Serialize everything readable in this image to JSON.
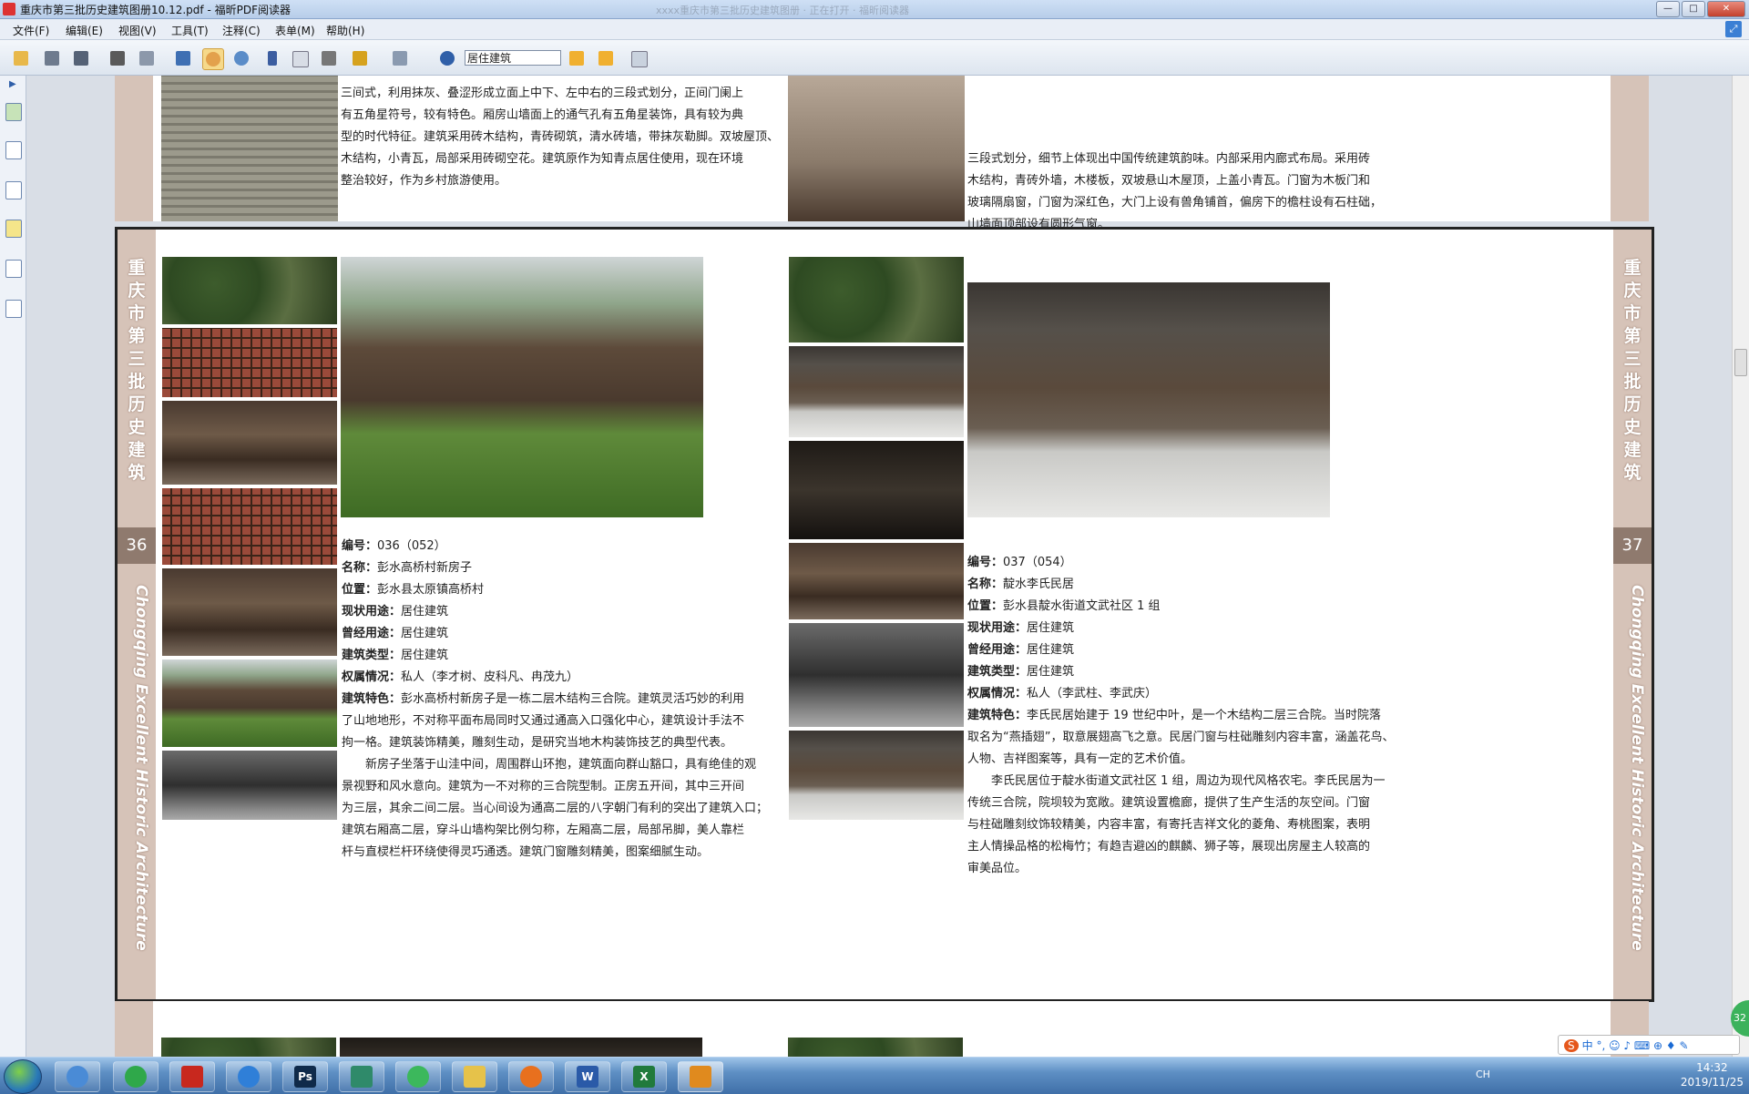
{
  "window": {
    "title": "重庆市第三批历史建筑图册10.12.pdf - 福昕PDF阅读器",
    "ghost_title": "xxxx重庆市第三批历史建筑图册 · 正在打开 · 福昕阅读器",
    "min": "—",
    "max": "□",
    "close": "✕"
  },
  "menu": [
    "文件(F)",
    "编辑(E)",
    "视图(V)",
    "工具(T)",
    "注释(C)",
    "表单(M)",
    "帮助(H)"
  ],
  "toolbar": {
    "search_value": "居住建筑",
    "buttons": [
      "open-icon",
      "save-icon",
      "save-all-icon",
      "print-icon",
      "print-setup-icon",
      "select-icon",
      "hand-icon",
      "zoom-icon",
      "pointer-icon",
      "annotate-icon",
      "snapshot-icon",
      "sign-icon",
      "stamp-icon",
      "search-icon",
      "find-prev-icon",
      "find-next-icon",
      "find-options-icon"
    ]
  },
  "page_top": {
    "left_text": [
      "三间式，利用抹灰、叠涩形成立面上中下、左中右的三段式划分，正间门阑上",
      "有五角星符号，较有特色。厢房山墙面上的通气孔有五角星装饰，具有较为典",
      "型的时代特征。建筑采用砖木结构，青砖砌筑，清水砖墙，带抹灰勒脚。双坡屋顶、",
      "木结构，小青瓦，局部采用砖砌空花。建筑原作为知青点居住使用，现在环境",
      "整治较好，作为乡村旅游使用。"
    ],
    "right_text": [
      "三段式划分，细节上体现出中国传统建筑韵味。内部采用内廊式布局。采用砖",
      "木结构，青砖外墙，木楼板，双坡悬山木屋顶，上盖小青瓦。门窗为木板门和",
      "玻璃隔扇窗，门窗为深红色，大门上设有兽角铺首，偏房下的檐柱设有石柱础，",
      "山墙面顶部设有圆形气窗。"
    ]
  },
  "side_left": {
    "vertical_title": [
      "重",
      "庆",
      "市",
      "第",
      "三",
      "批",
      "历",
      "史",
      "建",
      "筑"
    ],
    "page_number": "36",
    "english": "Chongqing Excellent Historic Architecture"
  },
  "side_right": {
    "vertical_title": [
      "重",
      "庆",
      "市",
      "第",
      "三",
      "批",
      "历",
      "史",
      "建",
      "筑"
    ],
    "page_number": "37",
    "english": "Chongqing Excellent Historic Architecture"
  },
  "entry_left": {
    "fields": [
      {
        "label": "编号：",
        "value": "036（052）"
      },
      {
        "label": "名称：",
        "value": "彭水高桥村新房子"
      },
      {
        "label": "位置：",
        "value": "彭水县太原镇高桥村"
      },
      {
        "label": "现状用途：",
        "value": "居住建筑"
      },
      {
        "label": "曾经用途：",
        "value": "居住建筑"
      },
      {
        "label": "建筑类型：",
        "value": "居住建筑"
      },
      {
        "label": "权属情况：",
        "value": "私人（李才树、皮科凡、冉茂九）"
      }
    ],
    "feature_label": "建筑特色：",
    "feature_lines": [
      "彭水高桥村新房子是一栋二层木结构三合院。建筑灵活巧妙的利用",
      "了山地地形，不对称平面布局同时又通过通高入口强化中心，建筑设计手法不",
      "拘一格。建筑装饰精美，雕刻生动，是研究当地木构装饰技艺的典型代表。",
      "　　新房子坐落于山洼中间，周围群山环抱，建筑面向群山豁口，具有绝佳的观",
      "景视野和风水意向。建筑为一不对称的三合院型制。正房五开间，其中三开间",
      "为三层，其余二间二层。当心间设为通高二层的八字朝门有利的突出了建筑入口；",
      "建筑右厢高二层，穿斗山墙构架比例匀称，左厢高二层，局部吊脚，美人靠栏",
      "杆与直棂栏杆环绕使得灵巧通透。建筑门窗雕刻精美，图案细腻生动。"
    ]
  },
  "entry_right": {
    "fields": [
      {
        "label": "编号：",
        "value": "037（054）"
      },
      {
        "label": "名称：",
        "value": "靛水李氏民居"
      },
      {
        "label": "位置：",
        "value": "彭水县靛水街道文武社区 1 组"
      },
      {
        "label": "现状用途：",
        "value": "居住建筑"
      },
      {
        "label": "曾经用途：",
        "value": "居住建筑"
      },
      {
        "label": "建筑类型：",
        "value": "居住建筑"
      },
      {
        "label": "权属情况：",
        "value": "私人（李武柱、李武庆）"
      }
    ],
    "feature_label": "建筑特色：",
    "feature_lines": [
      "李氏民居始建于 19 世纪中叶，是一个木结构二层三合院。当时院落",
      "取名为“燕插翅”，取意展翅高飞之意。民居门窗与柱础雕刻内容丰富，涵盖花鸟、",
      "人物、吉祥图案等，具有一定的艺术价值。",
      "　　李氏民居位于靛水街道文武社区 1 组，周边为现代风格农宅。李氏民居为一",
      "传统三合院，院坝较为宽敞。建筑设置檐廊，提供了生产生活的灰空间。门窗",
      "与柱础雕刻纹饰较精美，内容丰富，有寄托吉祥文化的菱角、寿桃图案，表明",
      "主人情操品格的松梅竹；有趋吉避凶的麒麟、狮子等，展现出房屋主人较高的",
      "审美品位。"
    ]
  },
  "taskbar": {
    "apps": [
      "browser-icon",
      "wechat-green-icon",
      "acrobat-icon",
      "edge-icon",
      "photoshop-icon",
      "chart-app-icon",
      "wechat-icon",
      "file-explorer-icon",
      "firefox-icon",
      "word-icon",
      "excel-icon",
      "foxit-icon"
    ],
    "app_labels": {
      "photoshop": "Ps",
      "word": "W",
      "excel": "X"
    },
    "lang": "CH",
    "time": "14:32",
    "date": "2019/11/25",
    "ime_text": "中 °, ☺ ♪ ⌨ ⊕ ♦ ✎",
    "badge": "32"
  }
}
